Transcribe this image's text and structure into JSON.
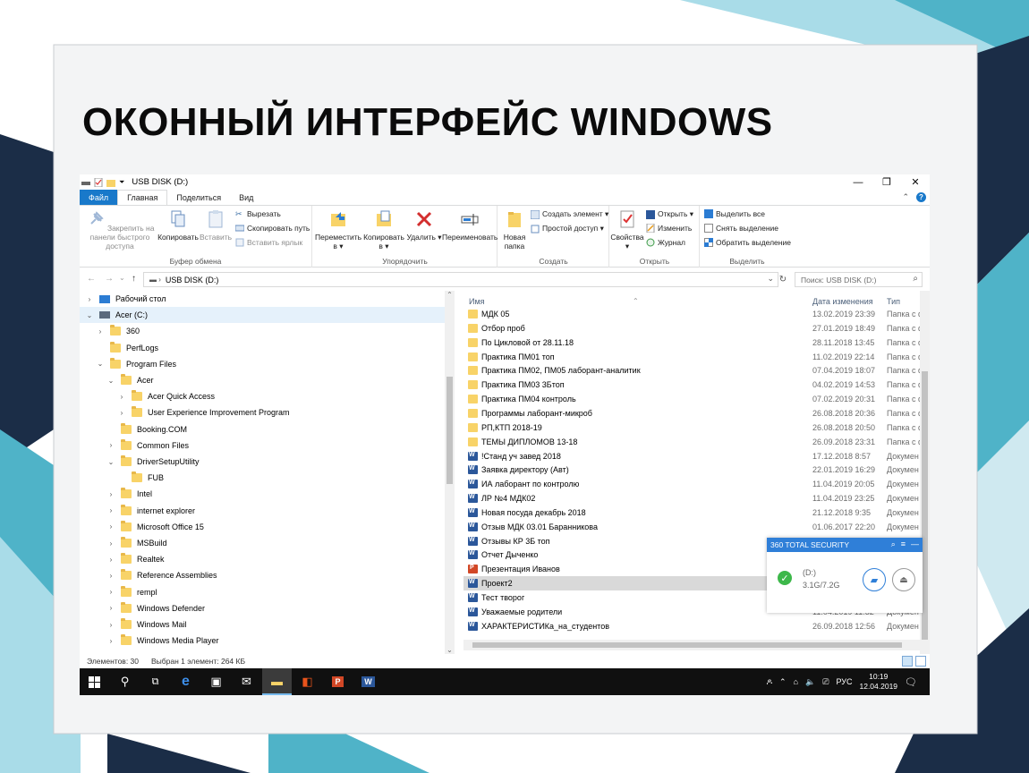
{
  "slide": {
    "title": "ОКОННЫЙ ИНТЕРФЕЙС WINDOWS",
    "colors": {
      "navy": "#1b2d47",
      "teal": "#4fb3c8",
      "light_teal": "#a9dce8",
      "gray": "#c9ccd1"
    }
  },
  "window": {
    "title": "USB DISK (D:)",
    "controls": {
      "minimize": "—",
      "maximize": "❐",
      "close": "✕"
    }
  },
  "ribbon_tabs": {
    "file": "Файл",
    "home": "Главная",
    "share": "Поделиться",
    "view": "Вид"
  },
  "ribbon": {
    "clipboard": {
      "label": "Буфер обмена",
      "pin": "Закрепить на панели быстрого доступа",
      "copy": "Копировать",
      "paste": "Вставить",
      "cut": "Вырезать",
      "copy_path": "Скопировать путь",
      "paste_shortcut": "Вставить ярлык"
    },
    "organize": {
      "label": "Упорядочить",
      "move": "Переместить в ▾",
      "copy_to": "Копировать в ▾",
      "delete": "Удалить ▾",
      "rename": "Переименовать"
    },
    "create": {
      "label": "Создать",
      "new_folder": "Новая папка",
      "new_item": "Создать элемент ▾",
      "easy_access": "Простой доступ ▾"
    },
    "open": {
      "label": "Открыть",
      "properties": "Свойства ▾",
      "open": "Открыть ▾",
      "edit": "Изменить",
      "history": "Журнал"
    },
    "select": {
      "label": "Выделить",
      "select_all": "Выделить все",
      "select_none": "Снять выделение",
      "invert": "Обратить выделение"
    }
  },
  "address": {
    "path": "USB DISK (D:)",
    "search_placeholder": "Поиск: USB DISK (D:)"
  },
  "nav_tree": [
    {
      "label": "Рабочий стол",
      "indent": 0,
      "chevron": "›",
      "icon": "desktop"
    },
    {
      "label": "Acer (C:)",
      "indent": 0,
      "chevron": "⌄",
      "icon": "drive",
      "selected": true
    },
    {
      "label": "360",
      "indent": 1,
      "chevron": "›",
      "icon": "folder"
    },
    {
      "label": "PerfLogs",
      "indent": 1,
      "chevron": "",
      "icon": "folder"
    },
    {
      "label": "Program Files",
      "indent": 1,
      "chevron": "⌄",
      "icon": "folder"
    },
    {
      "label": "Acer",
      "indent": 2,
      "chevron": "⌄",
      "icon": "folder"
    },
    {
      "label": "Acer Quick Access",
      "indent": 3,
      "chevron": "›",
      "icon": "folder"
    },
    {
      "label": "User Experience Improvement Program",
      "indent": 3,
      "chevron": "›",
      "icon": "folder"
    },
    {
      "label": "Booking.COM",
      "indent": 2,
      "chevron": "",
      "icon": "folder"
    },
    {
      "label": "Common Files",
      "indent": 2,
      "chevron": "›",
      "icon": "folder"
    },
    {
      "label": "DriverSetupUtility",
      "indent": 2,
      "chevron": "⌄",
      "icon": "folder"
    },
    {
      "label": "FUB",
      "indent": 3,
      "chevron": "",
      "icon": "folder"
    },
    {
      "label": "Intel",
      "indent": 2,
      "chevron": "›",
      "icon": "folder"
    },
    {
      "label": "internet explorer",
      "indent": 2,
      "chevron": "›",
      "icon": "folder"
    },
    {
      "label": "Microsoft Office 15",
      "indent": 2,
      "chevron": "›",
      "icon": "folder"
    },
    {
      "label": "MSBuild",
      "indent": 2,
      "chevron": "›",
      "icon": "folder"
    },
    {
      "label": "Realtek",
      "indent": 2,
      "chevron": "›",
      "icon": "folder"
    },
    {
      "label": "Reference Assemblies",
      "indent": 2,
      "chevron": "›",
      "icon": "folder"
    },
    {
      "label": "rempl",
      "indent": 2,
      "chevron": "›",
      "icon": "folder"
    },
    {
      "label": "Windows Defender",
      "indent": 2,
      "chevron": "›",
      "icon": "folder"
    },
    {
      "label": "Windows Mail",
      "indent": 2,
      "chevron": "›",
      "icon": "folder"
    },
    {
      "label": "Windows Media Player",
      "indent": 2,
      "chevron": "›",
      "icon": "folder"
    }
  ],
  "file_columns": {
    "name": "Имя",
    "date": "Дата изменения",
    "type": "Тип"
  },
  "files": [
    {
      "name": "МДК 05",
      "date": "13.02.2019 23:39",
      "type": "Папка с ф",
      "icon": "folder"
    },
    {
      "name": "Отбор проб",
      "date": "27.01.2019 18:49",
      "type": "Папка с ф",
      "icon": "folder"
    },
    {
      "name": "По Цикловой от 28.11.18",
      "date": "28.11.2018 13:45",
      "type": "Папка с ф",
      "icon": "folder"
    },
    {
      "name": "Практика ПМ01 топ",
      "date": "11.02.2019 22:14",
      "type": "Папка с ф",
      "icon": "folder"
    },
    {
      "name": "Практика ПМ02, ПМ05 лаборант-аналитик",
      "date": "07.04.2019 18:07",
      "type": "Папка с ф",
      "icon": "folder"
    },
    {
      "name": "Практика ПМ03 3Бтоп",
      "date": "04.02.2019 14:53",
      "type": "Папка с ф",
      "icon": "folder"
    },
    {
      "name": "Практика ПМ04 контроль",
      "date": "07.02.2019 20:31",
      "type": "Папка с ф",
      "icon": "folder"
    },
    {
      "name": "Программы лаборант-микроб",
      "date": "26.08.2018 20:36",
      "type": "Папка с ф",
      "icon": "folder"
    },
    {
      "name": "РП,КТП 2018-19",
      "date": "26.08.2018 20:50",
      "type": "Папка с ф",
      "icon": "folder"
    },
    {
      "name": "ТЕМЫ ДИПЛОМОВ 13-18",
      "date": "26.09.2018 23:31",
      "type": "Папка с ф",
      "icon": "folder"
    },
    {
      "name": "!Станд уч завед 2018",
      "date": "17.12.2018 8:57",
      "type": "Докумен",
      "icon": "word"
    },
    {
      "name": "Заявка директору (Авт)",
      "date": "22.01.2019 16:29",
      "type": "Докумен",
      "icon": "word"
    },
    {
      "name": "ИА лаборант по контролю",
      "date": "11.04.2019 20:05",
      "type": "Докумен",
      "icon": "word"
    },
    {
      "name": "ЛР №4 МДК02",
      "date": "11.04.2019 23:25",
      "type": "Докумен",
      "icon": "word"
    },
    {
      "name": "Новая посуда декабрь 2018",
      "date": "21.12.2018 9:35",
      "type": "Докумен",
      "icon": "word"
    },
    {
      "name": "Отзыв МДК 03.01 Баранникова",
      "date": "01.06.2017 22:20",
      "type": "Докумен",
      "icon": "word"
    },
    {
      "name": "Отзывы КР 3Б топ",
      "date": "",
      "type": "",
      "icon": "word"
    },
    {
      "name": "Отчет Дыченко",
      "date": "",
      "type": "",
      "icon": "word"
    },
    {
      "name": "Презентация Иванов",
      "date": "",
      "type": "",
      "icon": "ppt"
    },
    {
      "name": "Проект2",
      "date": "",
      "type": "",
      "icon": "word",
      "selected": true
    },
    {
      "name": "Тест творог",
      "date": "",
      "type": "",
      "icon": "word"
    },
    {
      "name": "Уважаемые родители",
      "date": "11.04.2019 11:32",
      "type": "Докумен",
      "icon": "word"
    },
    {
      "name": "ХАРАКТЕРИСТИКа_на_студентов",
      "date": "26.09.2018 12:56",
      "type": "Докумен",
      "icon": "word"
    }
  ],
  "security_popup": {
    "title": "360 TOTAL SECURITY",
    "drive": "(D:)",
    "usage": "3.1G/7.2G"
  },
  "status": {
    "items": "Элементов: 30",
    "selected": "Выбран 1 элемент: 264 КБ"
  },
  "taskbar": {
    "lang": "РУС",
    "time": "10:19",
    "date": "12.04.2019"
  }
}
